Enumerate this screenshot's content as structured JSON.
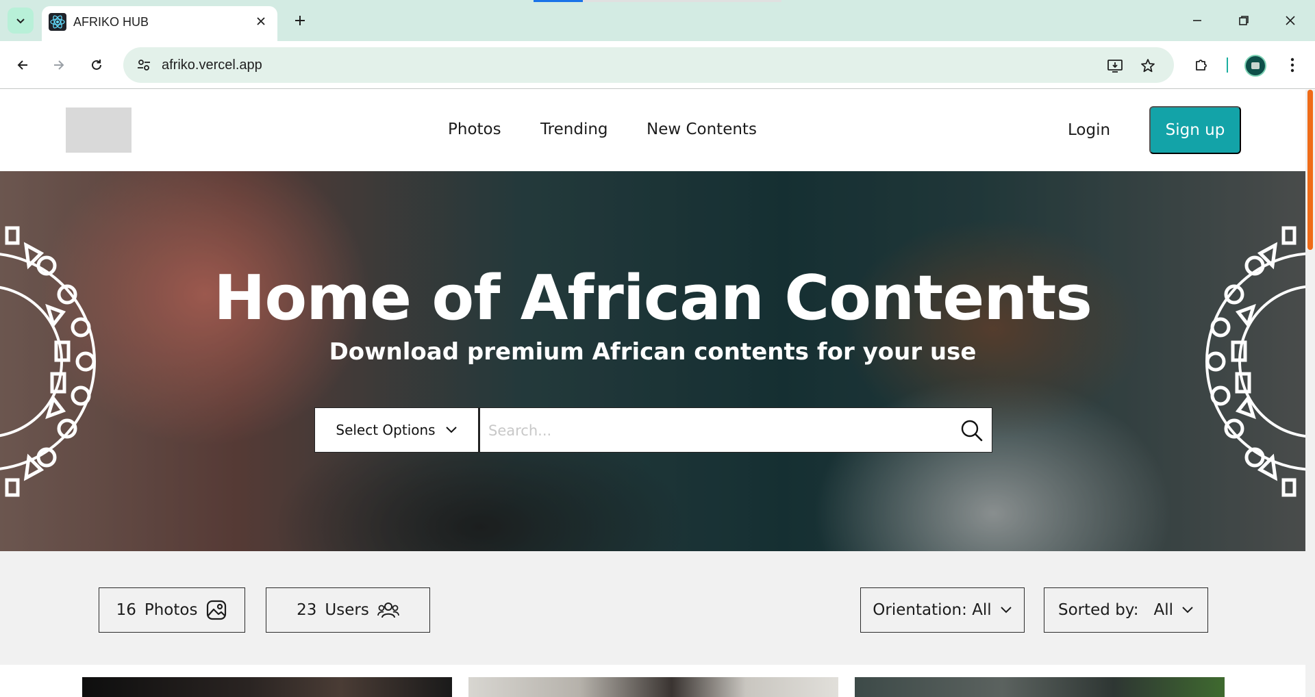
{
  "browser": {
    "tab_title": "AFRIKO HUB",
    "url": "afriko.vercel.app"
  },
  "header": {
    "nav": [
      "Photos",
      "Trending",
      "New Contents"
    ],
    "login_label": "Login",
    "signup_label": "Sign up",
    "accent_color": "#13a3a8"
  },
  "hero": {
    "title": "Home of African Contents",
    "subtitle": "Download premium African contents for your use",
    "select_label": "Select Options",
    "search_placeholder": "Search..."
  },
  "stats": {
    "photos_count": "16",
    "photos_label": "Photos",
    "users_count": "23",
    "users_label": "Users"
  },
  "filters": {
    "orientation_label": "Orientation: All",
    "sorted_label": "Sorted by:",
    "sorted_value": "All"
  }
}
